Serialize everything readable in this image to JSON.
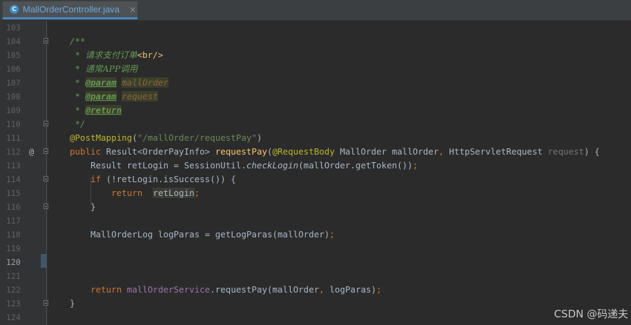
{
  "tab": {
    "filename": "MallOrderController.java",
    "icon_letter": "C",
    "icon": "java-class-icon",
    "close_glyph": "×"
  },
  "lines": [
    {
      "n": "103"
    },
    {
      "n": "104"
    },
    {
      "n": "105"
    },
    {
      "n": "106"
    },
    {
      "n": "107"
    },
    {
      "n": "108"
    },
    {
      "n": "109"
    },
    {
      "n": "110"
    },
    {
      "n": "111"
    },
    {
      "n": "112"
    },
    {
      "n": "113"
    },
    {
      "n": "114"
    },
    {
      "n": "115"
    },
    {
      "n": "116"
    },
    {
      "n": "117"
    },
    {
      "n": "118"
    },
    {
      "n": "119"
    },
    {
      "n": "120"
    },
    {
      "n": "121"
    },
    {
      "n": "122"
    },
    {
      "n": "123"
    },
    {
      "n": "124"
    }
  ],
  "code": {
    "l104": "/**",
    "l105_star": " * ",
    "l105_text": "请求支付订单",
    "l105_tag": "<br/>",
    "l106_star": " * ",
    "l106_text": "通常APP调用",
    "l107_star": " * ",
    "l107_tag": "@param",
    "l107_sp": " ",
    "l107_name": "mallOrder",
    "l108_star": " * ",
    "l108_tag": "@param",
    "l108_sp": " ",
    "l108_name": "request",
    "l109_star": " * ",
    "l109_tag": "@return",
    "l110": " */",
    "l111_ann": "@PostMapping",
    "l111_p1": "(",
    "l111_str": "\"/mallOrder/requestPay\"",
    "l111_p2": ")",
    "l112_kw": "public",
    "l112_t1": " Result<OrderPayInfo> ",
    "l112_fn": "requestPay",
    "l112_p1": "(",
    "l112_ann": "@RequestBody",
    "l112_t2": " MallOrder mallOrder",
    "l112_comma": ",",
    "l112_t3": " HttpServletRequest ",
    "l112_unused": "request",
    "l112_t4": ") {",
    "l113_t1": "    Result retLogin = SessionUtil.",
    "l113_static": "checkLogin",
    "l113_t2": "(mallOrder.getToken())",
    "l113_semi": ";",
    "l114_kw": "    if",
    "l114_t1": " (!retLogin.isSuccess()) {",
    "l115_kw": "        return",
    "l115_sp": "  ",
    "l115_var": "retLogin",
    "l115_semi": ";",
    "l116": "    }",
    "l118_t1": "    MallOrderLog logParas = getLogParas(mallOrder)",
    "l118_semi": ";",
    "l122_kw": "    return",
    "l122_sp": " ",
    "l122_field": "mallOrderService",
    "l122_t1": ".requestPay(mallOrder",
    "l122_comma": ",",
    "l122_t2": " logParas)",
    "l122_semi": ";",
    "l123": "}"
  },
  "gutter": {
    "l112_annot": "@"
  },
  "watermark": "CSDN @码递夫",
  "colors": {
    "background": "#2b2b2b",
    "gutter": "#313335",
    "keyword": "#cc7832",
    "string": "#6a8759",
    "annotation": "#bbb529",
    "javadoc": "#629755",
    "method": "#ffc66d",
    "field": "#9876aa",
    "text": "#a9b7c6",
    "tab_label": "#6ea6de"
  }
}
